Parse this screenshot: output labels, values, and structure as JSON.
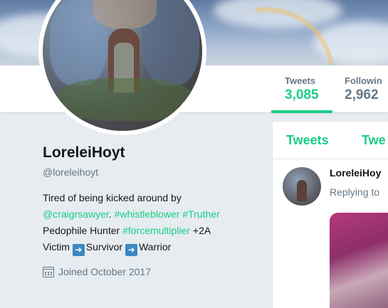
{
  "profile": {
    "display_name": "LoreleiHoyt",
    "handle": "@loreleihoyt",
    "bio": {
      "line1": "Tired of being kicked around by",
      "mention": "@craigrsawyer",
      "sep": ". ",
      "tag1": "#whistleblower",
      "tag2": "#Truther",
      "line3a": "Pedophile Hunter ",
      "tag3": "#forcemultiplier",
      "line3b": " +2A",
      "line4a": "Victim ",
      "line4b": "Survivor ",
      "line4c": "Warrior"
    },
    "joined": "Joined October 2017"
  },
  "stats": [
    {
      "label": "Tweets",
      "value": "3,085",
      "active": true
    },
    {
      "label": "Followin",
      "value": "2,962",
      "active": false
    }
  ],
  "timeline": {
    "tabs": [
      "Tweets",
      "Twe"
    ],
    "tweet": {
      "author": "LoreleiHoy",
      "reply": "Replying to"
    }
  },
  "colors": {
    "accent": "#19cf86",
    "muted": "#657786",
    "background": "#e6ecf0",
    "emoji_blue": "#3b88c3"
  },
  "icons": {
    "emoji_arrow": "right-arrow-emoji",
    "calendar": "calendar-icon"
  }
}
